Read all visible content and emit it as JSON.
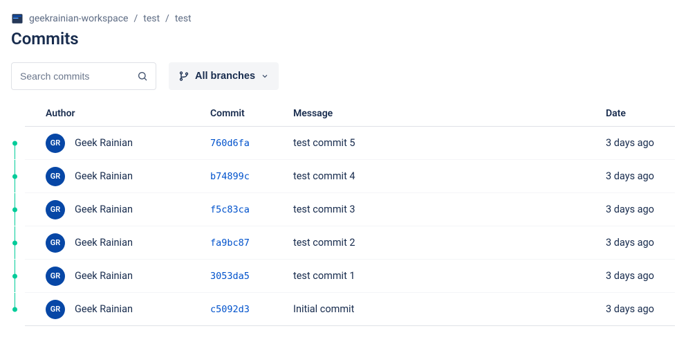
{
  "breadcrumbs": {
    "items": [
      "geekrainian-workspace",
      "test",
      "test"
    ]
  },
  "page": {
    "title": "Commits"
  },
  "search": {
    "placeholder": "Search commits"
  },
  "branchSelector": {
    "label": "All branches"
  },
  "table": {
    "headers": {
      "author": "Author",
      "commit": "Commit",
      "message": "Message",
      "date": "Date"
    },
    "rows": [
      {
        "avatar": "GR",
        "author": "Geek Rainian",
        "hash": "760d6fa",
        "message": "test commit 5",
        "date": "3 days ago"
      },
      {
        "avatar": "GR",
        "author": "Geek Rainian",
        "hash": "b74899c",
        "message": "test commit 4",
        "date": "3 days ago"
      },
      {
        "avatar": "GR",
        "author": "Geek Rainian",
        "hash": "f5c83ca",
        "message": "test commit 3",
        "date": "3 days ago"
      },
      {
        "avatar": "GR",
        "author": "Geek Rainian",
        "hash": "fa9bc87",
        "message": "test commit 2",
        "date": "3 days ago"
      },
      {
        "avatar": "GR",
        "author": "Geek Rainian",
        "hash": "3053da5",
        "message": "test commit 1",
        "date": "3 days ago"
      },
      {
        "avatar": "GR",
        "author": "Geek Rainian",
        "hash": "c5092d3",
        "message": "Initial commit",
        "date": "3 days ago"
      }
    ]
  }
}
